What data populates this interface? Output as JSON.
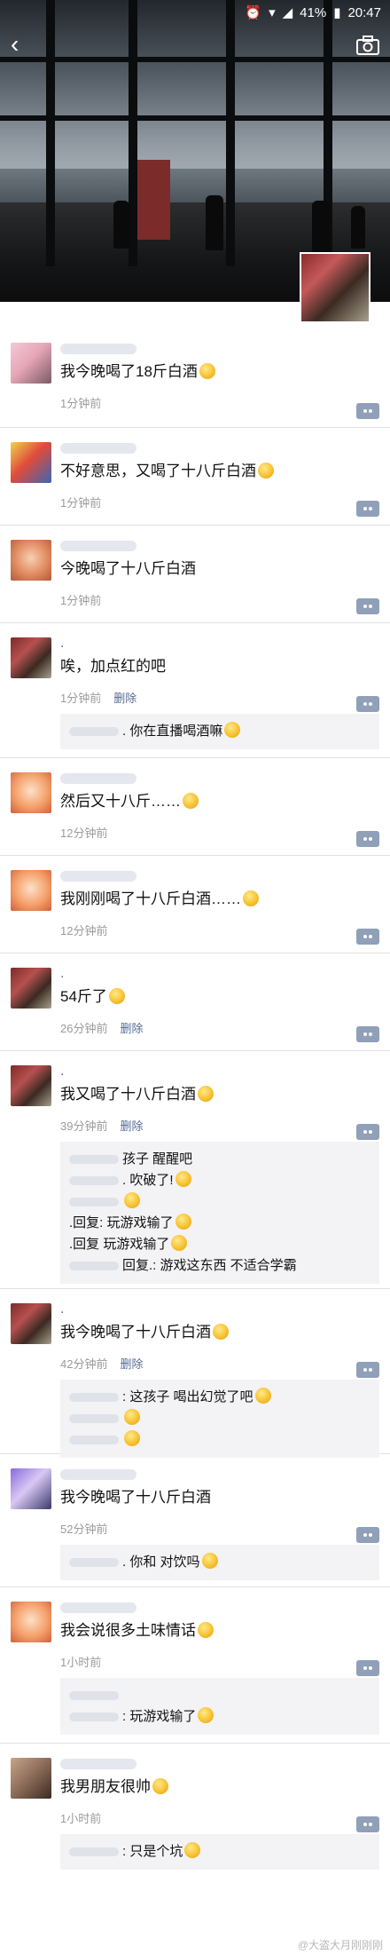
{
  "status_bar": {
    "battery": "41%",
    "time": "20:47"
  },
  "feed": {
    "posts": [
      {
        "text": "我今晚喝了18斤白酒",
        "time": "1分钟前",
        "delete": "",
        "comments": []
      },
      {
        "text": "不好意思，又喝了十八斤白酒",
        "time": "1分钟前",
        "delete": "",
        "comments": []
      },
      {
        "text": "今晚喝了十八斤白酒",
        "time": "1分钟前",
        "delete": "",
        "comments": []
      },
      {
        "text": "唉，加点红的吧",
        "time": "1分钟前",
        "delete": "删除",
        "comments": [
          ". 你在直播喝酒嘛"
        ]
      },
      {
        "text": "然后又十八斤……",
        "time": "12分钟前",
        "delete": "",
        "comments": []
      },
      {
        "text": "我刚刚喝了十八斤白酒……",
        "time": "12分钟前",
        "delete": "",
        "comments": []
      },
      {
        "text": "54斤了",
        "time": "26分钟前",
        "delete": "删除",
        "comments": []
      },
      {
        "text": "我又喝了十八斤白酒",
        "time": "39分钟前",
        "delete": "删除",
        "comments": [
          "孩子 醒醒吧",
          ". 吹破了!",
          "",
          ".回复: 玩游戏输了",
          ".回复 玩游戏输了",
          "回复.: 游戏这东西 不适合学霸"
        ]
      },
      {
        "text": "我今晚喝了十八斤白酒",
        "time": "42分钟前",
        "delete": "删除",
        "comments": [
          ": 这孩子 喝出幻觉了吧",
          "",
          ""
        ]
      },
      {
        "text": "我今晚喝了十八斤白酒",
        "time": "52分钟前",
        "delete": "",
        "comments": [
          ". 你和 对饮吗"
        ]
      },
      {
        "text": "我会说很多土味情话",
        "time": "1小时前",
        "delete": "",
        "comments": [
          "",
          ": 玩游戏输了"
        ]
      },
      {
        "text": "我男朋友很帅",
        "time": "1小时前",
        "delete": "",
        "comments": [
          ": 只是个坑"
        ]
      }
    ]
  },
  "watermark": "@大盗大月刚刚刚"
}
